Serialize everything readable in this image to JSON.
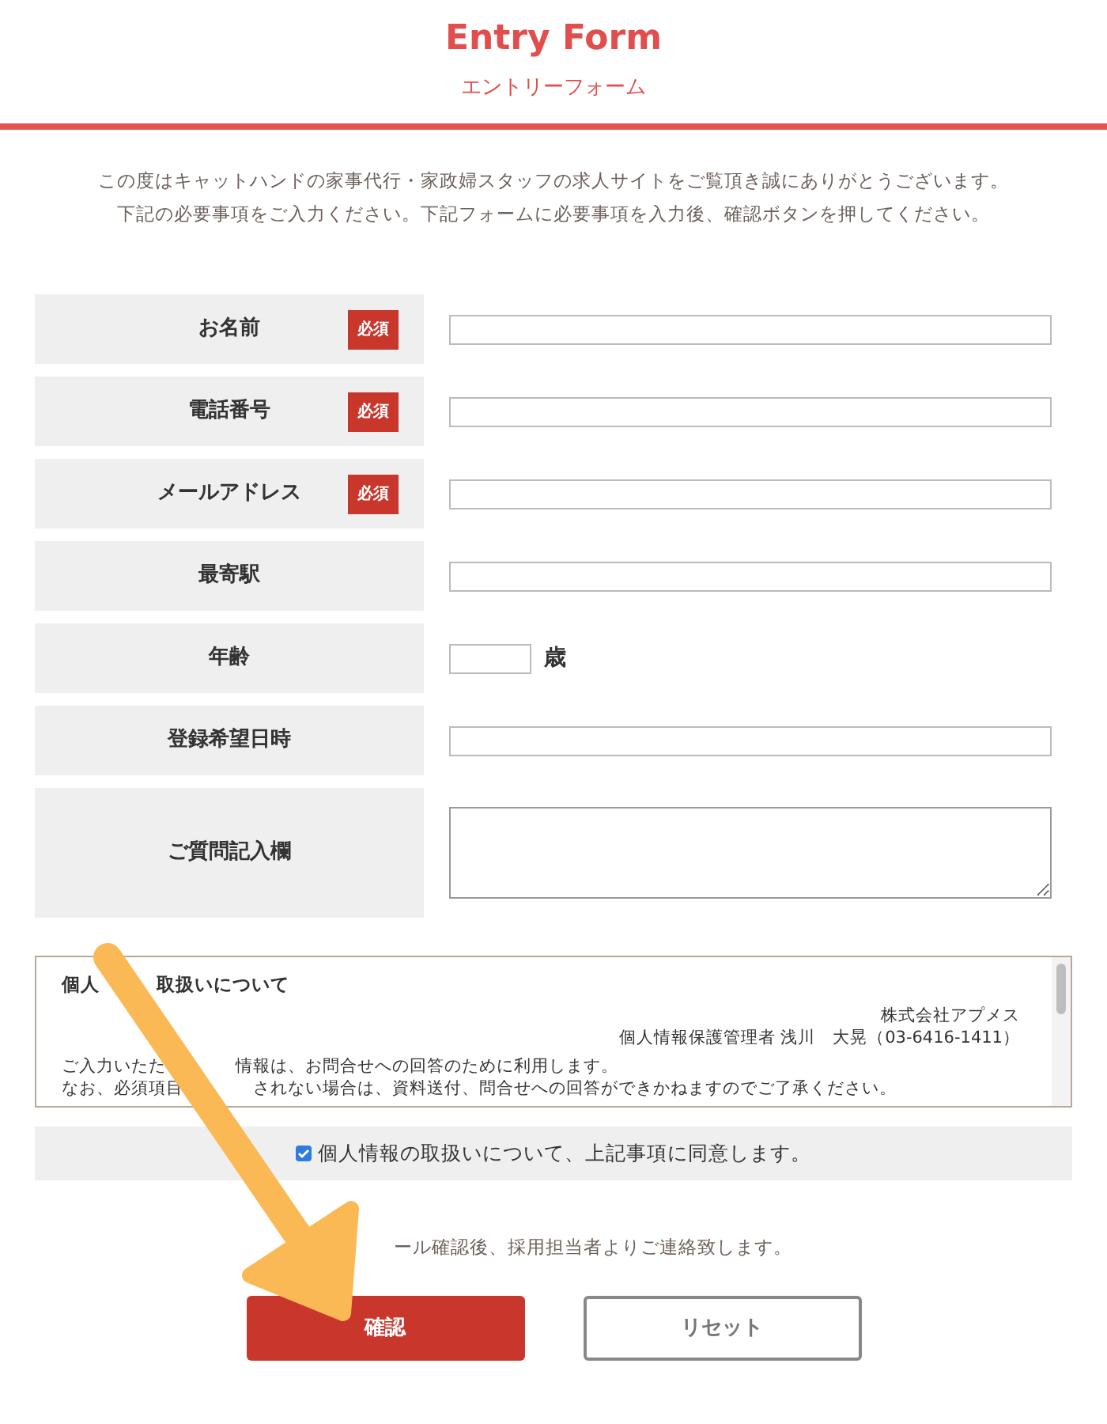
{
  "header": {
    "title": "Entry Form",
    "subtitle": "エントリーフォーム"
  },
  "intro": [
    "この度はキャットハンドの家事代行・家政婦スタッフの求人サイトをご覧頂き誠にありがとうございます。",
    "下記の必要事項をご入力ください。下記フォームに必要事項を入力後、確認ボタンを押してください。"
  ],
  "fields": [
    {
      "label": "お名前",
      "required": true,
      "required_label": "必須",
      "kind": "text"
    },
    {
      "label": "電話番号",
      "required": true,
      "required_label": "必須",
      "kind": "text"
    },
    {
      "label": "メールアドレス",
      "required": true,
      "required_label": "必須",
      "kind": "text"
    },
    {
      "label": "最寄駅",
      "required": false,
      "kind": "text"
    },
    {
      "label": "年齢",
      "required": false,
      "kind": "age",
      "unit": "歳"
    },
    {
      "label": "登録希望日時",
      "required": false,
      "kind": "text"
    },
    {
      "label": "ご質問記入欄",
      "required": false,
      "kind": "textarea"
    }
  ],
  "privacy": {
    "title_parts": [
      "個人",
      "取扱いについて"
    ],
    "company": "株式会社アプメス",
    "manager": "個人情報保護管理者 浅川　大晃（03-6416-1411）",
    "lines": [
      [
        "ご入力いただ",
        "情報は、お問合せへの回答のために利用します。"
      ],
      [
        "なお、必須項目",
        "されない場合は、資料送付、問合せへの回答ができかねますのでご了承ください。"
      ]
    ]
  },
  "agree": {
    "label": "個人情報の取扱いについて、上記事項に同意します。",
    "checked": true
  },
  "note": "ール確認後、採用担当者よりご連絡致します。",
  "buttons": [
    {
      "label": "確認",
      "kind": "primary"
    },
    {
      "label": "リセット",
      "kind": "secondary"
    }
  ]
}
